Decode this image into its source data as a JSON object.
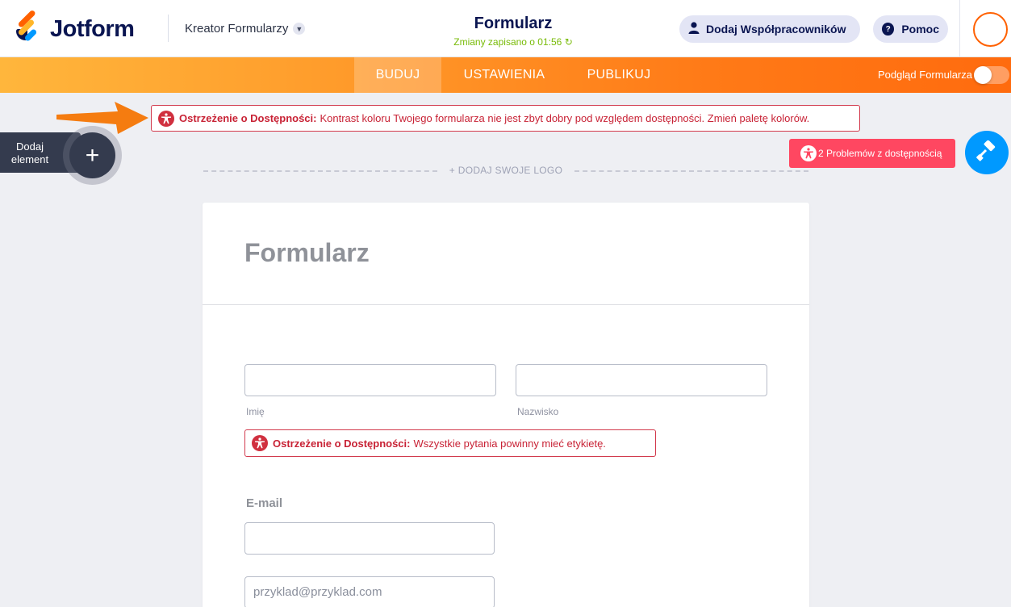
{
  "header": {
    "logo_text": "Jotform",
    "builder_label": "Kreator Formularzy",
    "form_title": "Formularz",
    "saved_status": "Zmiany zapisano o 01:56",
    "collaborators_label": "Dodaj Współpracowników",
    "help_label": "Pomoc"
  },
  "nav": {
    "tabs": [
      {
        "label": "BUDUJ",
        "active": true
      },
      {
        "label": "USTAWIENIA",
        "active": false
      },
      {
        "label": "PUBLIKUJ",
        "active": false
      }
    ],
    "preview_label": "Podgląd Formularza"
  },
  "warnings": {
    "top": {
      "title": "Ostrzeżenie o Dostępności:",
      "message": "Kontrast koloru Twojego formularza nie jest zbyt dobry pod względem dostępności. Zmień paletę kolorów."
    },
    "field": {
      "title": "Ostrzeżenie o Dostępności:",
      "message": "Wszystkie pytania powinny mieć etykietę."
    }
  },
  "add_element": {
    "line1": "Dodaj",
    "line2": "element"
  },
  "accessibility_issues_label": "2 Problemów z dostępnością",
  "add_logo_label": "+ DODAJ SWOJE LOGO",
  "form": {
    "title": "Formularz",
    "first_name_label": "Imię",
    "last_name_label": "Nazwisko",
    "email_label": "E-mail",
    "email_placeholder": "przyklad@przyklad.com"
  },
  "colors": {
    "brand_orange": "#ff6100",
    "warning_red": "#d23a4d",
    "issues_button": "#ff4761",
    "paint_button": "#0099ff",
    "saved_green": "#78bb07"
  }
}
